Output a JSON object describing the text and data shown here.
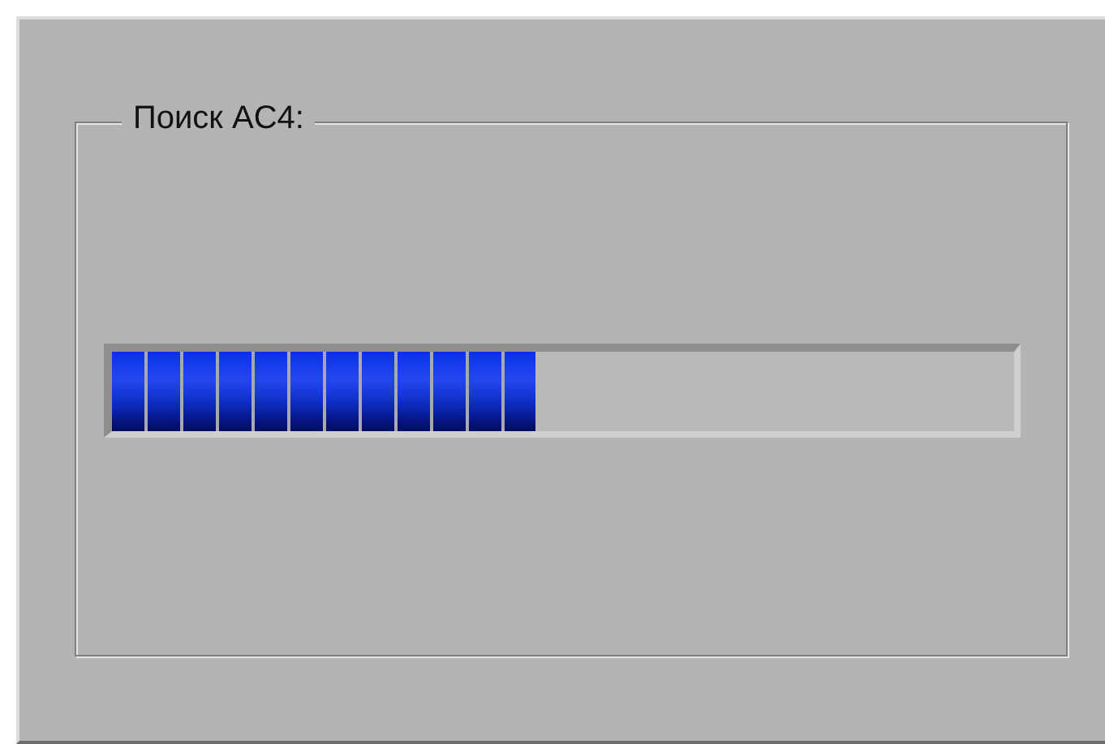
{
  "group": {
    "title": "Поиск AC4:"
  },
  "progress": {
    "level": 0.47
  }
}
